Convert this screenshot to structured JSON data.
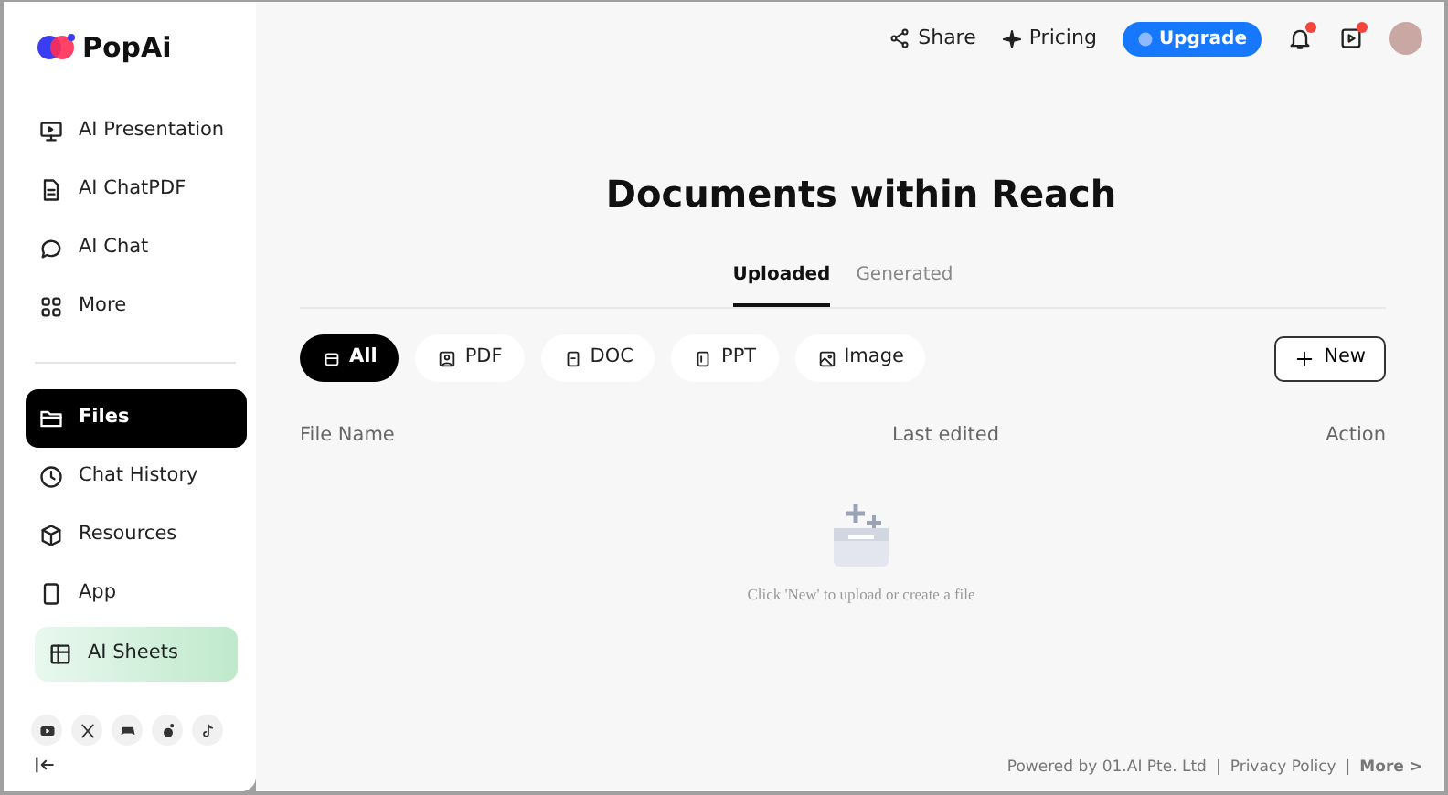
{
  "brand": {
    "name": "PopAi"
  },
  "sidebar": {
    "items": [
      {
        "label": "AI Presentation",
        "selected": false,
        "kind": "link"
      },
      {
        "label": "AI ChatPDF",
        "selected": false,
        "kind": "link"
      },
      {
        "label": "AI Chat",
        "selected": false,
        "kind": "link"
      },
      {
        "label": "More",
        "selected": false,
        "kind": "link"
      },
      {
        "kind": "divider"
      },
      {
        "label": "Files",
        "selected": true,
        "kind": "link"
      },
      {
        "label": "Chat History",
        "selected": false,
        "kind": "link"
      },
      {
        "label": "Resources",
        "selected": false,
        "kind": "link"
      },
      {
        "label": "App",
        "selected": false,
        "kind": "link"
      },
      {
        "label": "AI Sheets",
        "selected": false,
        "kind": "promo"
      }
    ]
  },
  "header": {
    "share": "Share",
    "pricing": "Pricing",
    "upgrade": "Upgrade",
    "notifications_unread": true,
    "video_unread": true
  },
  "title": "Documents within Reach",
  "tabs": [
    {
      "label": "Uploaded",
      "selected": true
    },
    {
      "label": "Generated",
      "selected": false
    }
  ],
  "filters": [
    {
      "label": "All",
      "selected": true
    },
    {
      "label": "PDF",
      "selected": false
    },
    {
      "label": "DOC",
      "selected": false
    },
    {
      "label": "PPT",
      "selected": false
    },
    {
      "label": "Image",
      "selected": false
    }
  ],
  "new_button": "New",
  "table": {
    "columns": [
      "File Name",
      "Last edited",
      "Action"
    ],
    "empty_text": "Click 'New' to upload or create a file"
  },
  "footer": {
    "powered": "Powered by 01.AI Pte. Ltd",
    "separator_1": "|",
    "privacy": "Privacy Policy",
    "separator_2": "|",
    "more": "More >"
  }
}
